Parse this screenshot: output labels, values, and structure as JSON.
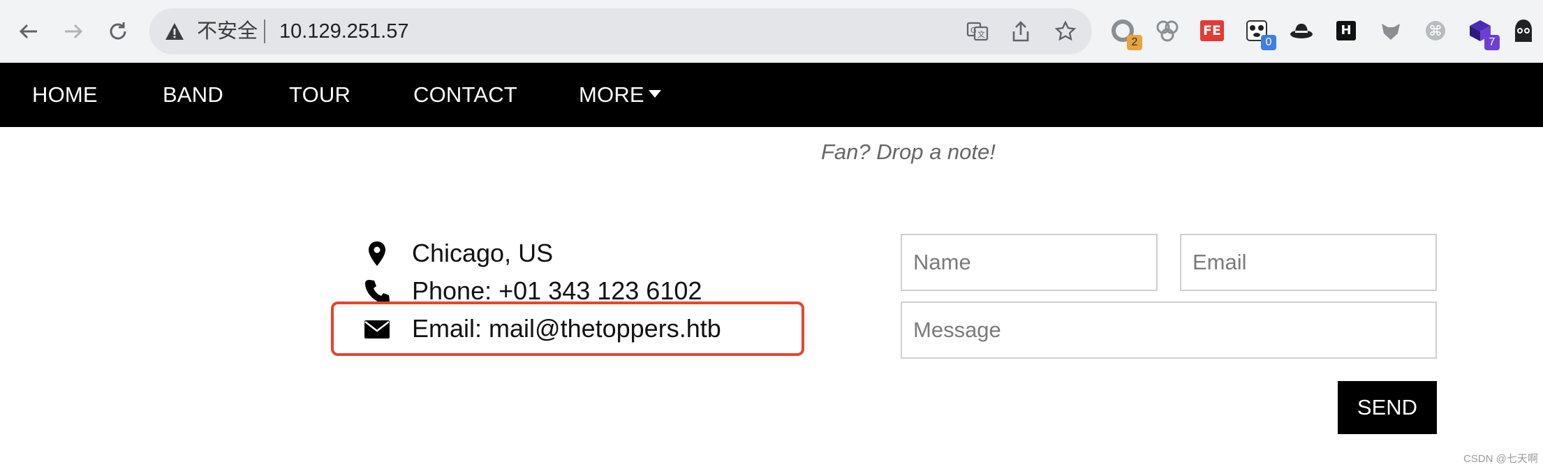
{
  "browser": {
    "insecure_label": "不安全",
    "url": "10.129.251.57",
    "extensions": [
      {
        "icon": "circle-extension-icon",
        "badge": "2",
        "badge_color": "#e8a33b"
      },
      {
        "icon": "bubbles-extension-icon",
        "badge": null
      },
      {
        "icon": "fe-extension-icon",
        "text": "FE"
      },
      {
        "icon": "panda-extension-icon",
        "badge": "0",
        "badge_color": "#3d7ee8"
      },
      {
        "icon": "hat-extension-icon",
        "badge": null
      },
      {
        "icon": "h-extension-icon",
        "text": "H"
      },
      {
        "icon": "fox-extension-icon",
        "badge": null
      },
      {
        "icon": "cmd-extension-icon",
        "badge": null
      },
      {
        "icon": "cube-extension-icon",
        "badge": "7",
        "badge_color": "#6d3fd4"
      },
      {
        "icon": "hacker-avatar-icon",
        "badge": null
      }
    ]
  },
  "nav": {
    "items": [
      "HOME",
      "BAND",
      "TOUR",
      "CONTACT"
    ],
    "more_label": "MORE"
  },
  "contact": {
    "tagline": "Fan? Drop a note!",
    "location": "Chicago, US",
    "phone": "Phone: +01 343 123 6102",
    "email": "Email: mail@thetoppers.htb"
  },
  "form": {
    "name_placeholder": "Name",
    "email_placeholder": "Email",
    "message_placeholder": "Message",
    "send_label": "SEND"
  },
  "watermark": "CSDN @七天啊",
  "colors": {
    "highlight": "#e8442f",
    "nav_bg": "#000000",
    "page_bg": "#ffffff"
  }
}
